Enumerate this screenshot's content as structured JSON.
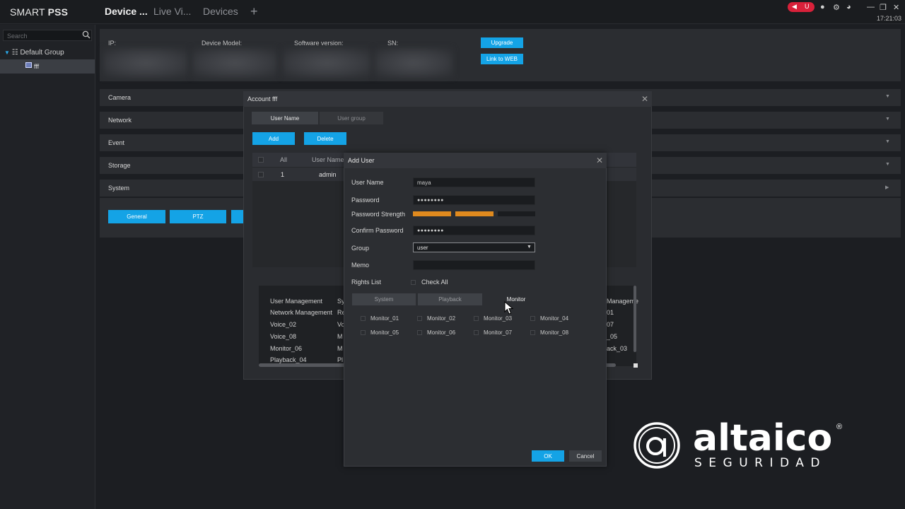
{
  "app": {
    "title_light": "SMART ",
    "title_bold": "PSS",
    "clock": "17:21:03"
  },
  "tabs": [
    {
      "label": "Device ...",
      "active": true
    },
    {
      "label": "Live Vi...",
      "active": false
    },
    {
      "label": "Devices",
      "active": false
    }
  ],
  "tab_add": "+",
  "tray": {
    "left": "◀",
    "right": "U"
  },
  "sidebar": {
    "search_placeholder": "Search",
    "group_label": "Default Group",
    "device_label": "fff"
  },
  "device_info": {
    "ip_label": "IP:",
    "model_label": "Device Model:",
    "software_label": "Software version:",
    "sn_label": "SN:",
    "upgrade_label": "Upgrade",
    "link_web_label": "Link to WEB"
  },
  "sections": [
    "Camera",
    "Network",
    "Event",
    "Storage",
    "System"
  ],
  "system_buttons": [
    "General",
    "PTZ"
  ],
  "account_dialog": {
    "title": "Account fff",
    "tab_username": "User Name",
    "tab_usergroup": "User group",
    "add_label": "Add",
    "delete_label": "Delete",
    "col_all": "All",
    "col_username": "User Name",
    "row_index": "1",
    "row_username": "admin",
    "rights_col1": [
      "User Management",
      "Network Management",
      "Voice_02",
      "Voice_08",
      "Monitor_06",
      "Playback_04"
    ],
    "rights_col2": [
      "Sy",
      "Re",
      "Vo",
      "M",
      "M",
      "Pl"
    ],
    "rights_col3": [
      "Manageme",
      "01",
      "07",
      "_05",
      "ack_03"
    ]
  },
  "add_user": {
    "title": "Add User",
    "username_label": "User Name",
    "username_value": "maya",
    "password_label": "Password",
    "password_value": "●●●●●●●●",
    "strength_label": "Password Strength",
    "strength_level": 0.67,
    "confirm_label": "Confirm Password",
    "confirm_value": "●●●●●●●●",
    "group_label": "Group",
    "group_value": "user",
    "memo_label": "Memo",
    "memo_value": "",
    "rights_label": "Rights List",
    "check_all_label": "Check All",
    "right_tabs": [
      {
        "label": "System",
        "active": false
      },
      {
        "label": "Playback",
        "active": false
      },
      {
        "label": "Monitor",
        "active": true
      }
    ],
    "monitors": [
      "Monitor_01",
      "Monitor_02",
      "Monitor_03",
      "Monitor_04",
      "Monitor_05",
      "Monitor_06",
      "Monitor_07",
      "Monitor_08"
    ],
    "ok_label": "OK",
    "cancel_label": "Cancel"
  },
  "logo": {
    "name": "altaico",
    "sub": "SEGURIDAD",
    "reg": "®"
  },
  "colors": {
    "accent": "#14a3e6",
    "strength": "#e08a1e",
    "tray": "#d8213a"
  }
}
